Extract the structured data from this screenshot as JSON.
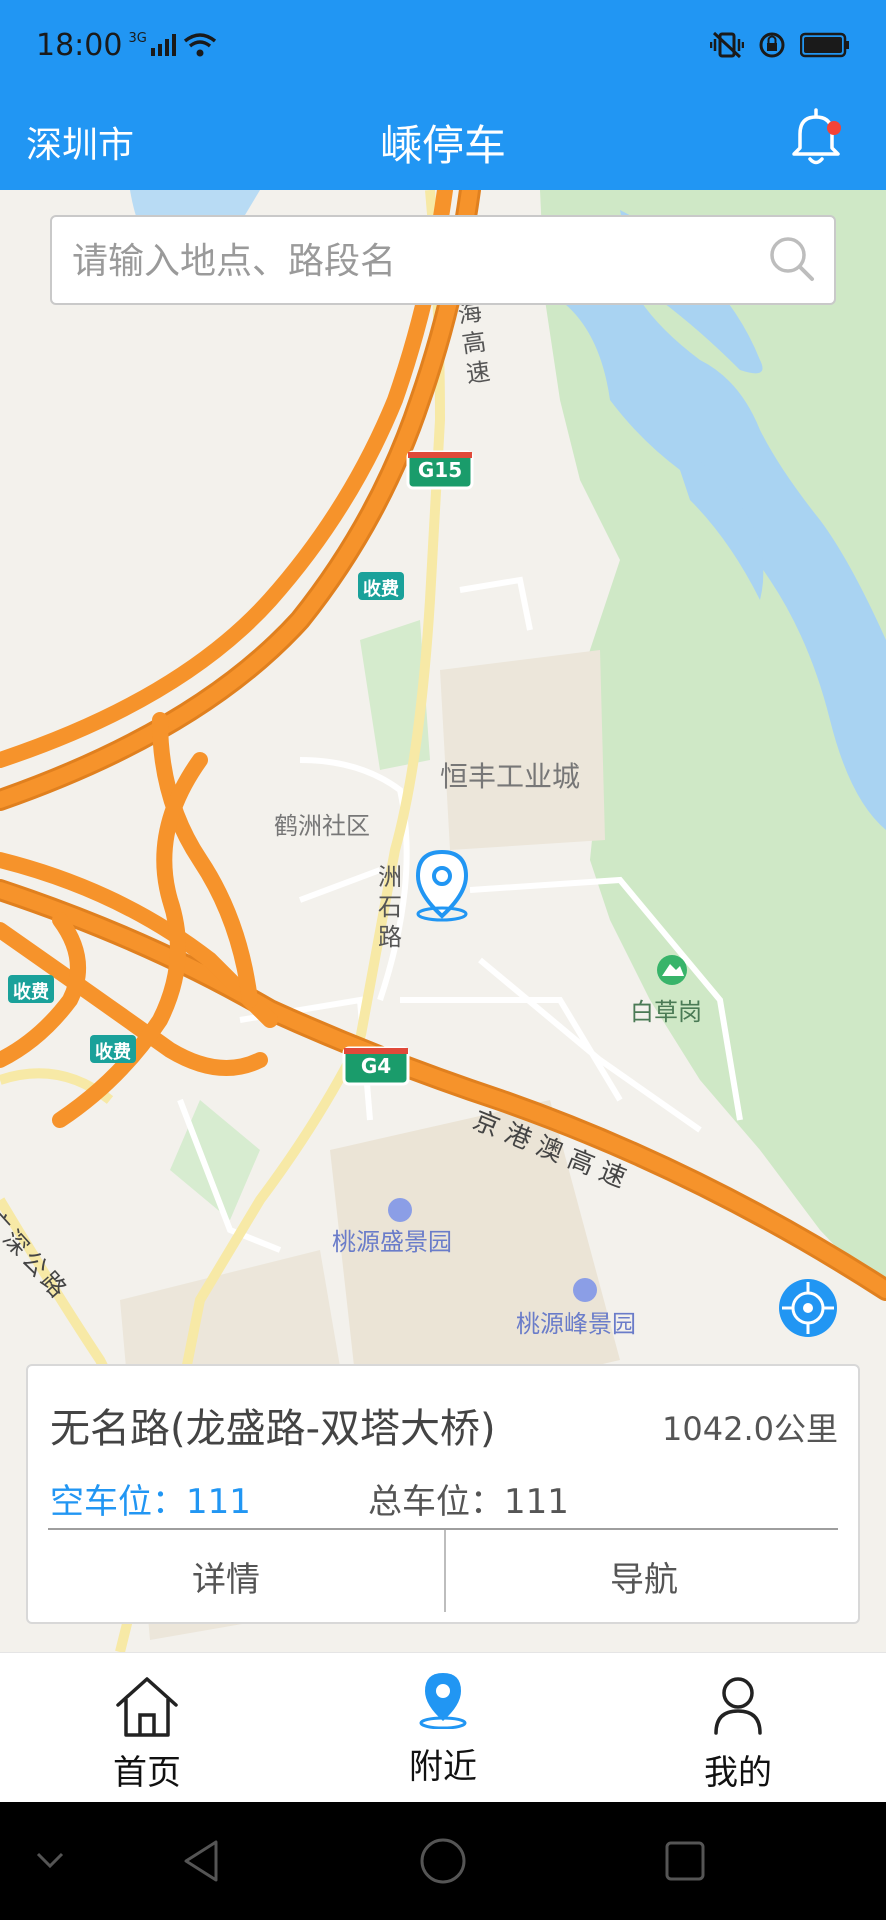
{
  "status": {
    "time": "18:00",
    "network": "3G"
  },
  "header": {
    "city": "深圳市",
    "title": "嵊停车"
  },
  "search": {
    "placeholder": "请输入地点、路段名"
  },
  "map_labels": {
    "expressway_top": [
      "海",
      "高",
      "速"
    ],
    "g15": "G15",
    "g4": "G4",
    "toll1": "收费",
    "toll2": "收费",
    "toll3": "收费",
    "hengfeng": "恒丰工业城",
    "hezhou": "鹤洲社区",
    "zhoushi": [
      "洲",
      "石",
      "路"
    ],
    "baicaogang": "白草岗",
    "jinggangao": [
      "京",
      "港",
      "澳",
      "高",
      "速"
    ],
    "taoyuan_sheng": "桃源盛景园",
    "taoyuan_feng": "桃源峰景园",
    "guangshen": [
      "广",
      "深",
      "公",
      "路"
    ]
  },
  "card": {
    "road_name": "无名路(龙盛路-双塔大桥)",
    "distance": "1042.0公里",
    "free_spaces": "空车位：111",
    "total_spaces": "总车位：111",
    "detail_label": "详情",
    "nav_label": "导航"
  },
  "tabs": [
    {
      "label": "首页",
      "icon": "home-icon"
    },
    {
      "label": "附近",
      "icon": "location-pin-icon"
    },
    {
      "label": "我的",
      "icon": "user-icon"
    }
  ],
  "colors": {
    "primary": "#2196f3",
    "notification_dot": "#f44336",
    "expressway": "#f6932b",
    "water": "#a9d3f2",
    "green": "#cde7c3"
  }
}
